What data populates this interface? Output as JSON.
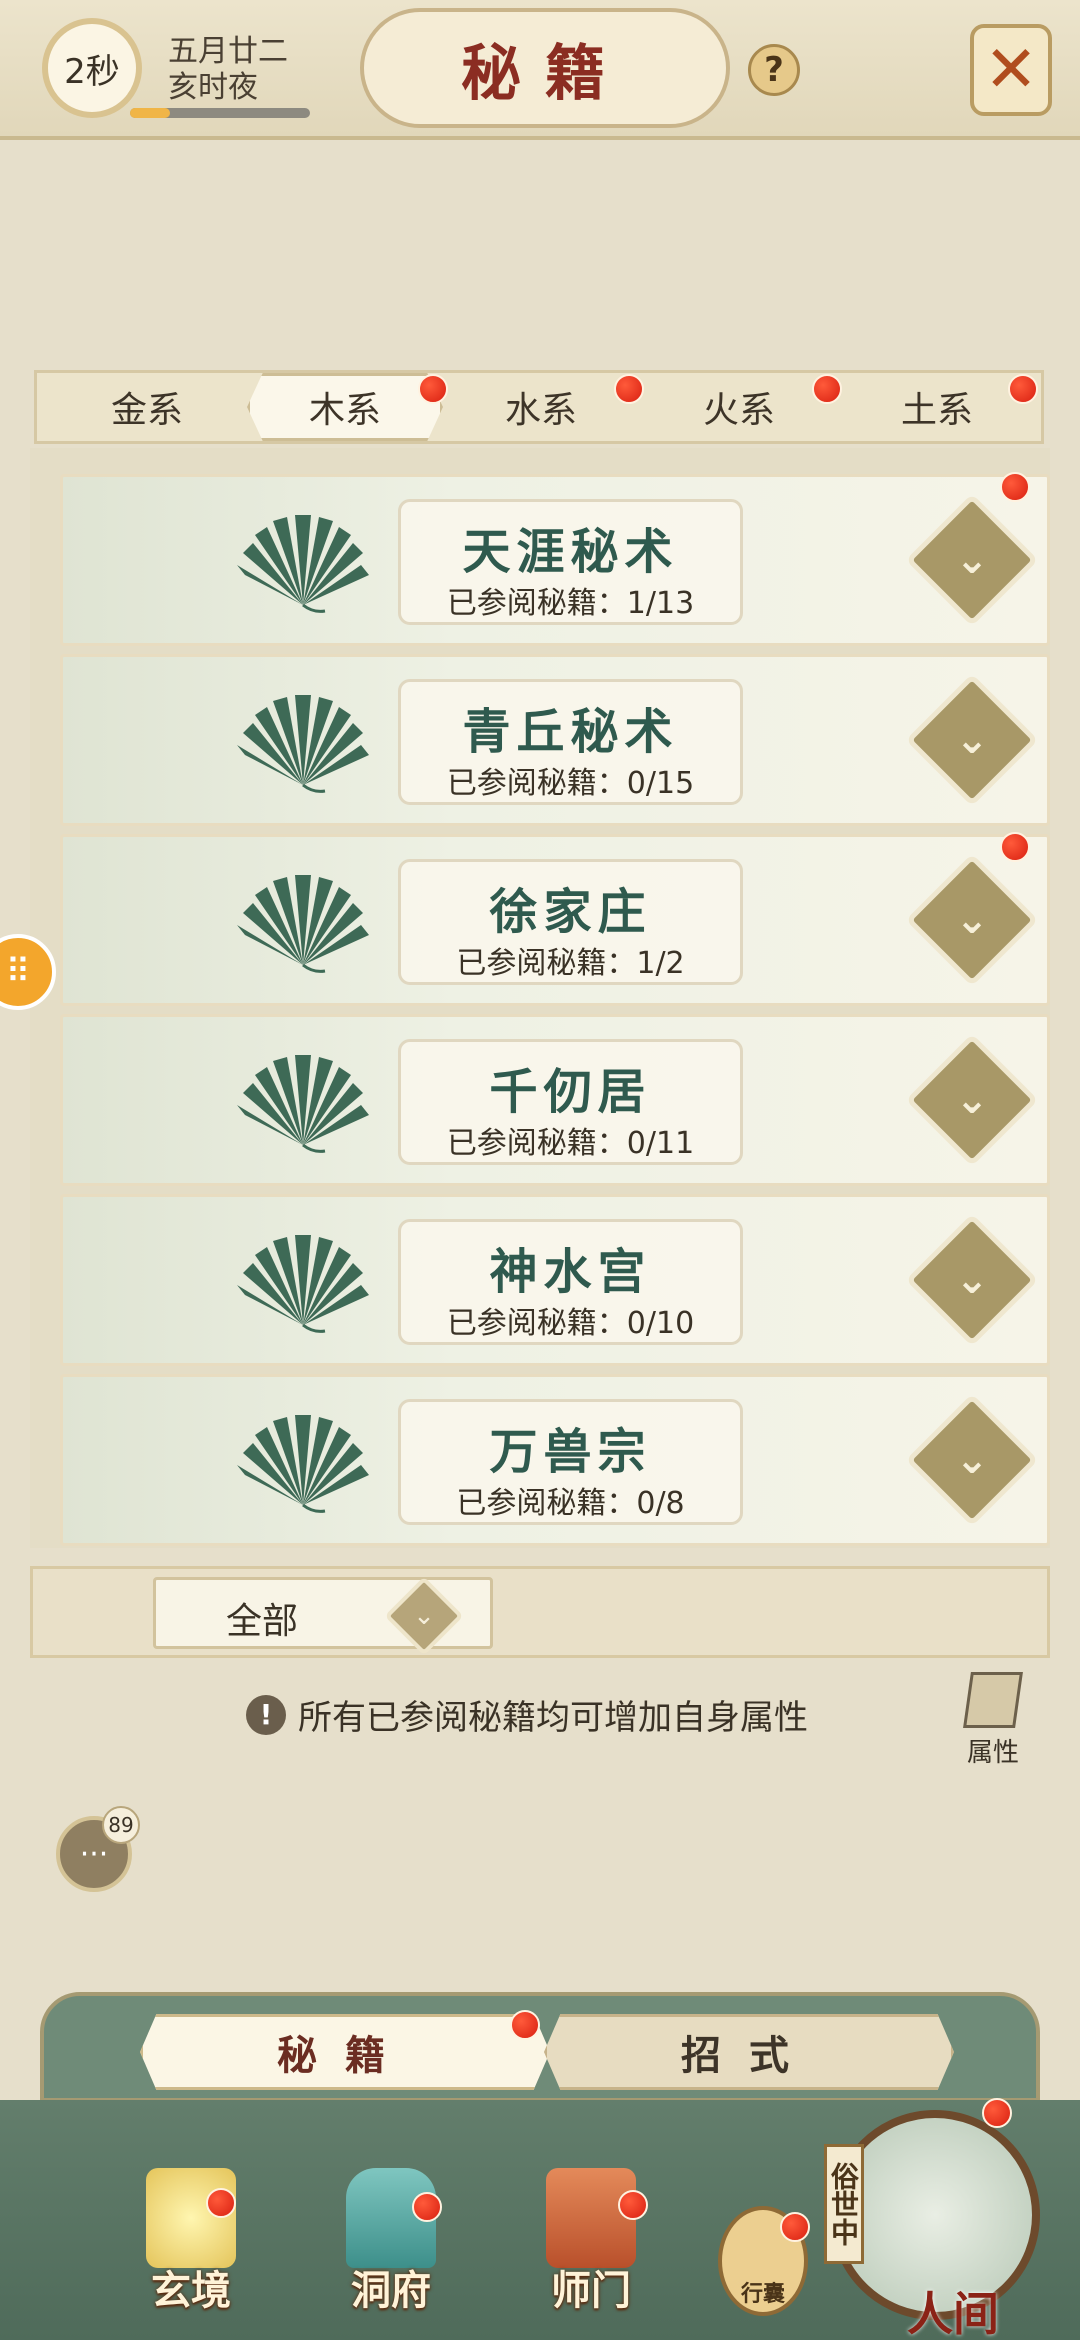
{
  "header": {
    "timer": "2秒",
    "date_line1": "五月廿二",
    "date_line2": "亥时夜",
    "title": "秘籍",
    "help": "?",
    "close": "✕",
    "time_progress": 0.22
  },
  "tabs": [
    {
      "label": "金系",
      "active": false,
      "dot": false
    },
    {
      "label": "木系",
      "active": true,
      "dot": true
    },
    {
      "label": "水系",
      "active": false,
      "dot": true
    },
    {
      "label": "火系",
      "active": false,
      "dot": true
    },
    {
      "label": "土系",
      "active": false,
      "dot": true
    }
  ],
  "sects": [
    {
      "name": "天涯秘术",
      "progress": "已参阅秘籍：1/13",
      "dot": true
    },
    {
      "name": "青丘秘术",
      "progress": "已参阅秘籍：0/15",
      "dot": false
    },
    {
      "name": "徐家庄",
      "progress": "已参阅秘籍：1/2",
      "dot": true
    },
    {
      "name": "千仞居",
      "progress": "已参阅秘籍：0/11",
      "dot": false
    },
    {
      "name": "神水宫",
      "progress": "已参阅秘籍：0/10",
      "dot": false
    },
    {
      "name": "万兽宗",
      "progress": "已参阅秘籍：0/8",
      "dot": false
    }
  ],
  "filter": {
    "selected": "全部",
    "icon": "chevron-down-icon"
  },
  "info": {
    "text": "所有已参阅秘籍均可增加自身属性",
    "icon": "exclamation-icon"
  },
  "attribute_button": {
    "label": "属性"
  },
  "chat": {
    "badge": "89"
  },
  "subtabs": [
    {
      "label": "秘籍",
      "active": true,
      "dot": true
    },
    {
      "label": "招式",
      "active": false,
      "dot": false
    }
  ],
  "bottom_nav": [
    {
      "label": "玄境",
      "dot": true
    },
    {
      "label": "洞府",
      "dot": true
    },
    {
      "label": "师门",
      "dot": true
    }
  ],
  "bag": {
    "label": "行囊",
    "dot": true
  },
  "world": {
    "vertical": "俗世中",
    "label": "人间",
    "dot": true
  },
  "colors": {
    "accent_red": "#d81f10",
    "title_red": "#8b2d22",
    "name_green": "#2f5a4e"
  }
}
